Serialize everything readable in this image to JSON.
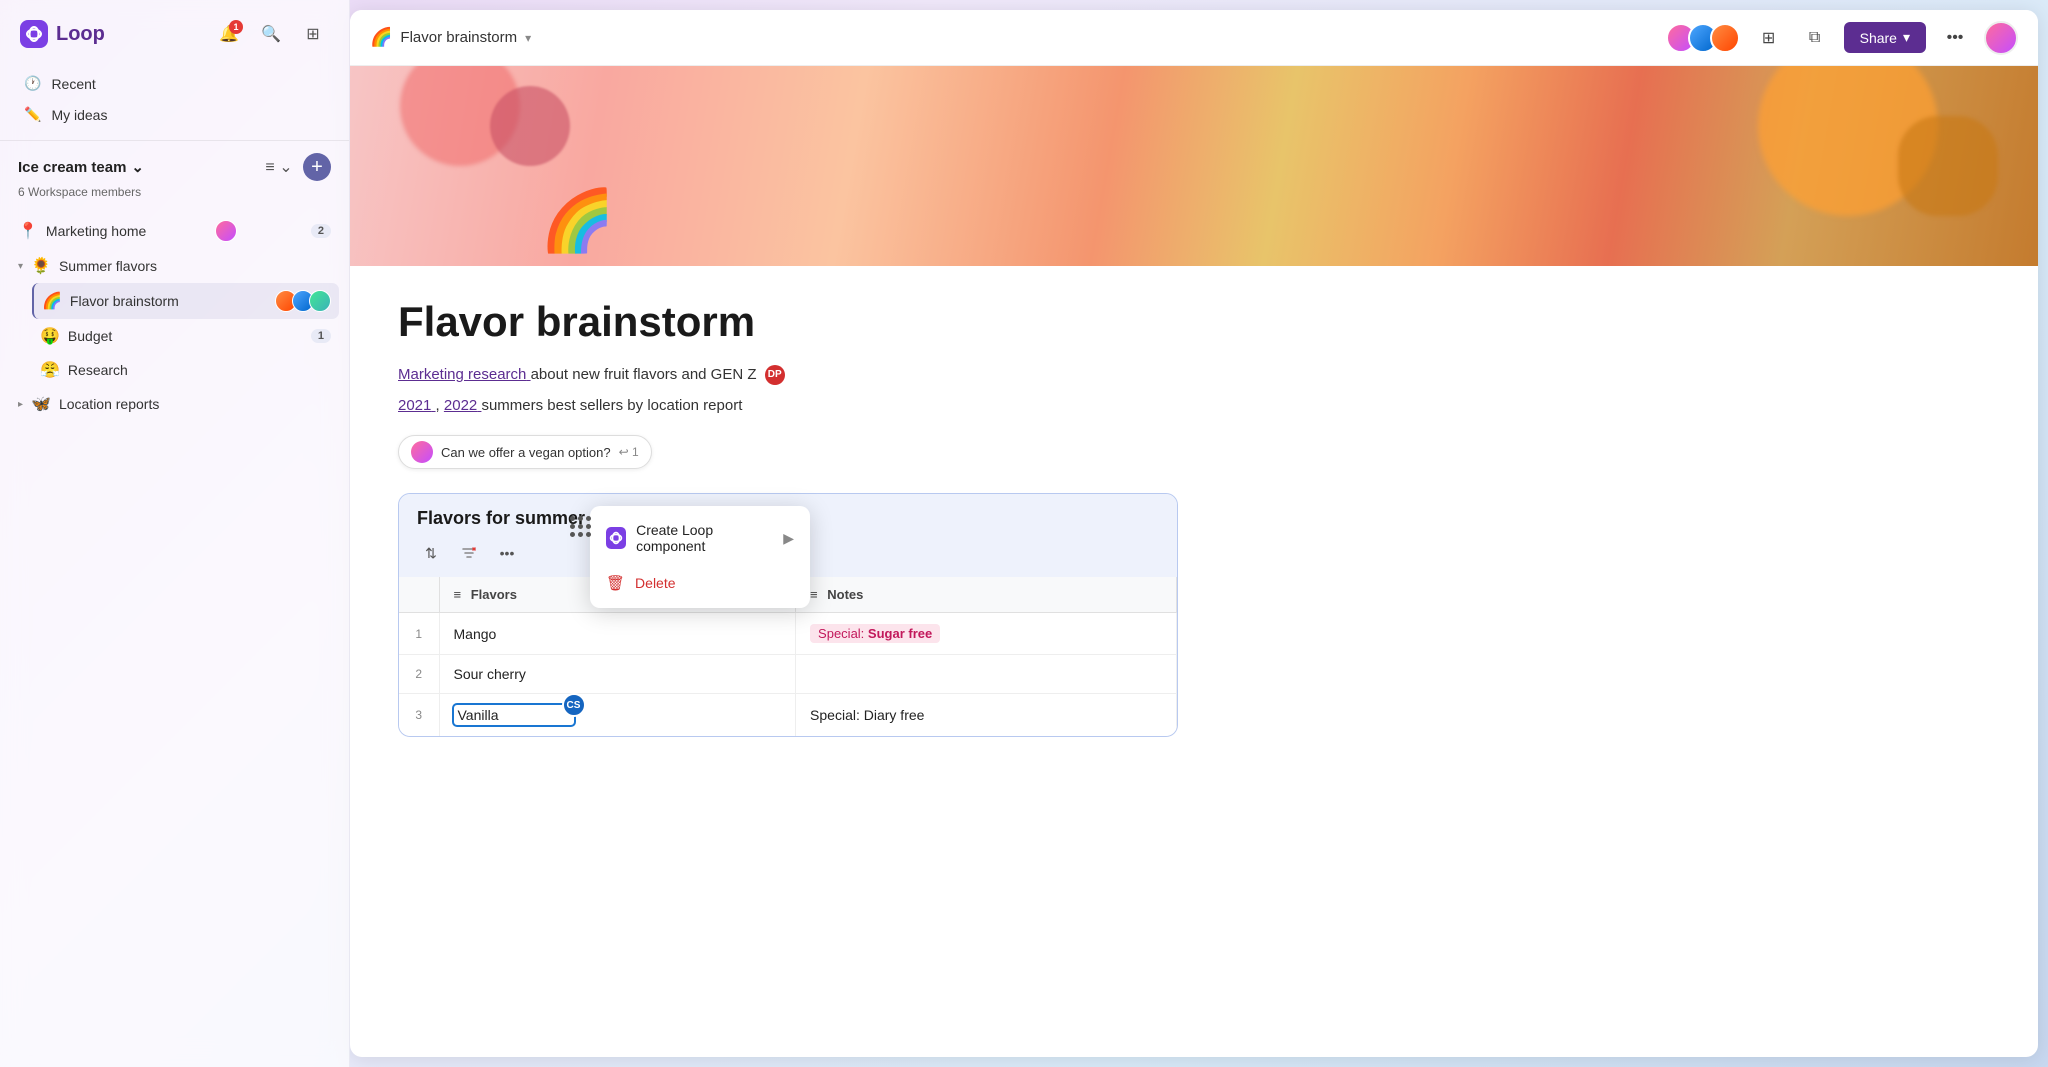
{
  "app": {
    "name": "Loop",
    "logo_label": "Loop"
  },
  "sidebar": {
    "notification_count": "1",
    "workspace": {
      "name": "Ice cream team",
      "member_count": "6 Workspace members"
    },
    "nav": [
      {
        "id": "recent",
        "label": "Recent",
        "icon": "clock"
      },
      {
        "id": "myideas",
        "label": "My ideas",
        "icon": "pen"
      }
    ],
    "tree": [
      {
        "id": "marketing-home",
        "label": "Marketing home",
        "emoji": "📍",
        "badge": "2",
        "level": 0
      },
      {
        "id": "summer-flavors",
        "label": "Summer flavors",
        "emoji": "🌻",
        "expanded": true,
        "level": 0
      },
      {
        "id": "flavor-brainstorm",
        "label": "Flavor brainstorm",
        "emoji": "🌈",
        "active": true,
        "level": 1
      },
      {
        "id": "budget",
        "label": "Budget",
        "emoji": "🤑",
        "badge": "1",
        "level": 1
      },
      {
        "id": "research",
        "label": "Research",
        "emoji": "😤",
        "level": 1
      },
      {
        "id": "location-reports",
        "label": "Location reports",
        "emoji": "🦋",
        "level": 0,
        "collapsed": true
      }
    ]
  },
  "context_menu": {
    "items": [
      {
        "id": "create-loop",
        "label": "Create Loop component",
        "icon": "loop"
      },
      {
        "id": "delete",
        "label": "Delete",
        "icon": "trash"
      }
    ]
  },
  "header": {
    "page_title": "Flavor brainstorm",
    "share_label": "Share",
    "share_chevron": "▾"
  },
  "page": {
    "title": "Flavor brainstorm",
    "description_link1": "Marketing research",
    "description_text1": " about new fruit flavors and GEN Z",
    "description_link2": "2021",
    "description_comma": ", ",
    "description_link3": "2022",
    "description_text2": " summers best sellers by location report",
    "comment_text": "Can we offer a vegan option?",
    "comment_count": "↩ 1"
  },
  "table": {
    "title": "Flavors for summer 2023",
    "columns": [
      {
        "id": "num",
        "label": ""
      },
      {
        "id": "flavors",
        "label": "Flavors"
      },
      {
        "id": "notes",
        "label": "Notes"
      }
    ],
    "rows": [
      {
        "num": "1",
        "flavor": "Mango",
        "notes": "Special: Sugar free",
        "notes_type": "tag"
      },
      {
        "num": "2",
        "flavor": "Sour cherry",
        "notes": "",
        "notes_type": "plain"
      },
      {
        "num": "3",
        "flavor": "Vanilla",
        "notes": "Special: Diary free",
        "notes_type": "plain",
        "editing": true
      }
    ]
  },
  "colors": {
    "primary": "#5c2d91",
    "accent": "#6264a7",
    "table_border": "#b8c9f0",
    "table_bg": "#f0f4ff"
  }
}
